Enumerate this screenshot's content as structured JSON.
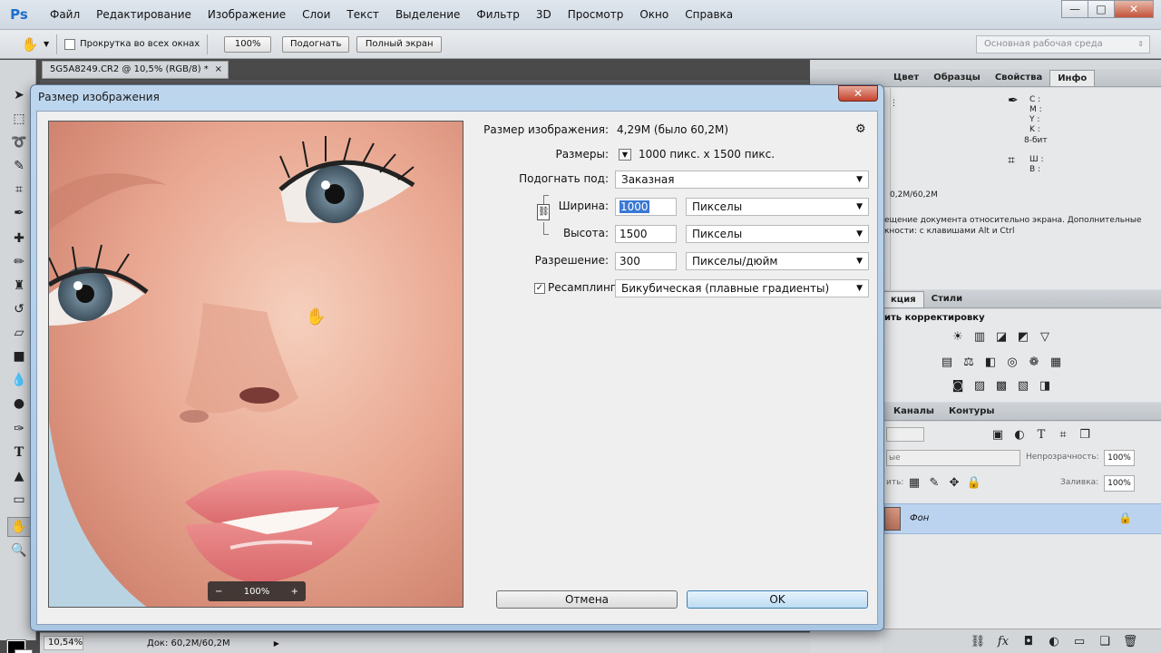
{
  "app": {
    "logo": "Ps",
    "menu": [
      "Файл",
      "Редактирование",
      "Изображение",
      "Слои",
      "Текст",
      "Выделение",
      "Фильтр",
      "3D",
      "Просмотр",
      "Окно",
      "Справка"
    ],
    "window_controls": {
      "minimize": "—",
      "maximize": "□",
      "close": "✕"
    }
  },
  "options_bar": {
    "scroll_all_windows": "Прокрутка во всех окнах",
    "zoom_100": "100%",
    "fit": "Подогнать",
    "full_screen": "Полный экран",
    "workspace": "Основная рабочая среда"
  },
  "document": {
    "tab_title": "5G5A8249.CR2 @ 10,5% (RGB/8) *",
    "tab_close": "×"
  },
  "status_bar": {
    "zoom": "10,54%",
    "doc": "Док: 60,2M/60,2M"
  },
  "panels": {
    "top_tabs": [
      "Цвет",
      "Образцы",
      "Свойства",
      "Инфо"
    ],
    "info": {
      "cmyk": [
        "C :",
        "M :",
        "Y :",
        "K :"
      ],
      "bit_depth": "8-бит",
      "xy": [
        "X :",
        "Y :"
      ],
      "wh": [
        "Ш :",
        "В :"
      ],
      "doc_size": "0,2M/60,2M",
      "hint": "ещение документа относительно экрана. Дополнительные кности: с клавишами Alt и Ctrl"
    },
    "adjust_tabs": [
      "кция",
      "Стили"
    ],
    "adjust_title": "ить корректировку",
    "layers_tabs": [
      "Каналы",
      "Контуры"
    ],
    "opacity_label": "Непрозрачность:",
    "opacity_value": "100%",
    "fill_label": "Заливка:",
    "fill_value": "100%",
    "blend_mode": "ые",
    "lock_label": "ить:",
    "layer_name": "Фон"
  },
  "dialog": {
    "title": "Размер изображения",
    "close": "✕",
    "image_size_label": "Размер изображения:",
    "image_size_value": "4,29M (было 60,2M)",
    "dimensions_label": "Размеры:",
    "dimensions_value": "1000 пикс. x 1500 пикс.",
    "fit_label": "Подогнать под:",
    "fit_value": "Заказная",
    "width_label": "Ширина:",
    "width_value": "1000",
    "width_unit": "Пикселы",
    "height_label": "Высота:",
    "height_value": "1500",
    "height_unit": "Пикселы",
    "resolution_label": "Разрешение:",
    "resolution_value": "300",
    "resolution_unit": "Пикселы/дюйм",
    "resample_label": "Ресамплинг",
    "resample_checked": "✓",
    "resample_value": "Бикубическая (плавные градиенты)",
    "preview_zoom": "100%",
    "zoom_minus": "−",
    "zoom_plus": "+",
    "cancel": "Отмена",
    "ok": "OK",
    "gear": "⚙",
    "chain": "⛓"
  }
}
